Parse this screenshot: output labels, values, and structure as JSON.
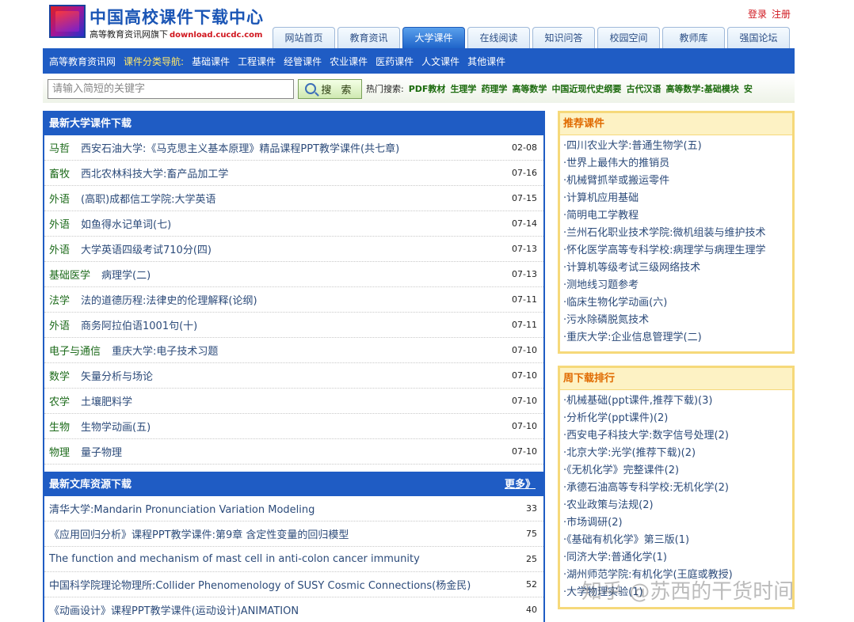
{
  "header": {
    "title": "中国高校课件下载中心",
    "subtitle": "高等教育资讯网旗下",
    "domain": "download.cucdc.com",
    "login": "登录",
    "register": "注册"
  },
  "main_tabs": [
    {
      "label": "网站首页",
      "active": false
    },
    {
      "label": "教育资讯",
      "active": false
    },
    {
      "label": "大学课件",
      "active": true
    },
    {
      "label": "在线阅读",
      "active": false
    },
    {
      "label": "知识问答",
      "active": false
    },
    {
      "label": "校园空间",
      "active": false
    },
    {
      "label": "教师库",
      "active": false
    },
    {
      "label": "强国论坛",
      "active": false
    }
  ],
  "cat_bar": {
    "site": "高等教育资讯网",
    "label": "课件分类导航:",
    "items": [
      "基础课件",
      "工程课件",
      "经管课件",
      "农业课件",
      "医药课件",
      "人文课件",
      "其他课件"
    ]
  },
  "search": {
    "placeholder": "请输入简短的关键字",
    "button": "搜 索",
    "hot_label": "热门搜索:",
    "hot_items": [
      "PDF教材",
      "生理学",
      "药理学",
      "高等数学",
      "中国近现代史纲要",
      "古代汉语",
      "高等数学:基础模块",
      "安"
    ]
  },
  "latest_courses": {
    "title": "最新大学课件下载",
    "rows": [
      {
        "cat": "马哲",
        "title": "西安石油大学:《马克思主义基本原理》精品课程PPT教学课件(共七章)",
        "date": "02-08"
      },
      {
        "cat": "畜牧",
        "title": "西北农林科技大学:畜产品加工学",
        "date": "07-16"
      },
      {
        "cat": "外语",
        "title": "(高职)成都信工学院:大学英语",
        "date": "07-15"
      },
      {
        "cat": "外语",
        "title": "如鱼得水记单词(七)",
        "date": "07-14"
      },
      {
        "cat": "外语",
        "title": "大学英语四级考试710分(四)",
        "date": "07-13"
      },
      {
        "cat": "基础医学",
        "title": "病理学(二)",
        "date": "07-13"
      },
      {
        "cat": "法学",
        "title": "法的道德历程:法律史的伦理解释(论纲)",
        "date": "07-11"
      },
      {
        "cat": "外语",
        "title": "商务阿拉伯语1001句(十)",
        "date": "07-11"
      },
      {
        "cat": "电子与通信",
        "title": "重庆大学:电子技术习题",
        "date": "07-10"
      },
      {
        "cat": "数学",
        "title": "矢量分析与场论",
        "date": "07-10"
      },
      {
        "cat": "农学",
        "title": "土壤肥料学",
        "date": "07-10"
      },
      {
        "cat": "生物",
        "title": "生物学动画(五)",
        "date": "07-10"
      },
      {
        "cat": "物理",
        "title": "量子物理",
        "date": "07-10"
      }
    ]
  },
  "latest_library": {
    "title": "最新文库资源下载",
    "more": "更多》",
    "rows": [
      {
        "title": "清华大学:Mandarin Pronunciation Variation Modeling",
        "count": "33"
      },
      {
        "title": "《应用回归分析》课程PPT教学课件:第9章 含定性变量的回归模型",
        "count": "75"
      },
      {
        "title": "The function and mechanism of mast cell in anti-colon cancer immunity",
        "count": "25"
      },
      {
        "title": "中国科学院理论物理所:Collider Phenomenology of SUSY Cosmic Connections(杨金民)",
        "count": "52"
      },
      {
        "title": "《动画设计》课程PPT教学课件(运动设计)ANIMATION",
        "count": "40"
      }
    ]
  },
  "recommended": {
    "title": "推荐课件",
    "items": [
      "·四川农业大学:普通生物学(五)",
      "·世界上最伟大的推销员",
      "·机械臂抓举或搬运零件",
      "·计算机应用基础",
      "·简明电工学教程",
      "·兰州石化职业技术学院:微机组装与维护技术",
      "·怀化医学高等专科学校:病理学与病理生理学",
      "·计算机等级考试三级网络技术",
      "·测地线习题参考",
      "·临床生物化学动画(六)",
      "·污水除磷脱氮技术",
      "·重庆大学:企业信息管理学(二)"
    ]
  },
  "weekly_rank": {
    "title": "周下载排行",
    "items": [
      "·机械基础(ppt课件,推荐下载)(3)",
      "·分析化学(ppt课件)(2)",
      "·西安电子科技大学:数字信号处理(2)",
      "·北京大学:光学(推荐下载)(2)",
      "·《无机化学》完整课件(2)",
      "·承德石油高等专科学校:无机化学(2)",
      "·农业政策与法规(2)",
      "·市场调研(2)",
      "·《基础有机化学》第三版(1)",
      "·同济大学:普通化学(1)",
      "·湖州师范学院:有机化学(王庭或教授)",
      "·大学物理实验(1)"
    ]
  },
  "watermark": "知乎 @苏西的干货时间"
}
